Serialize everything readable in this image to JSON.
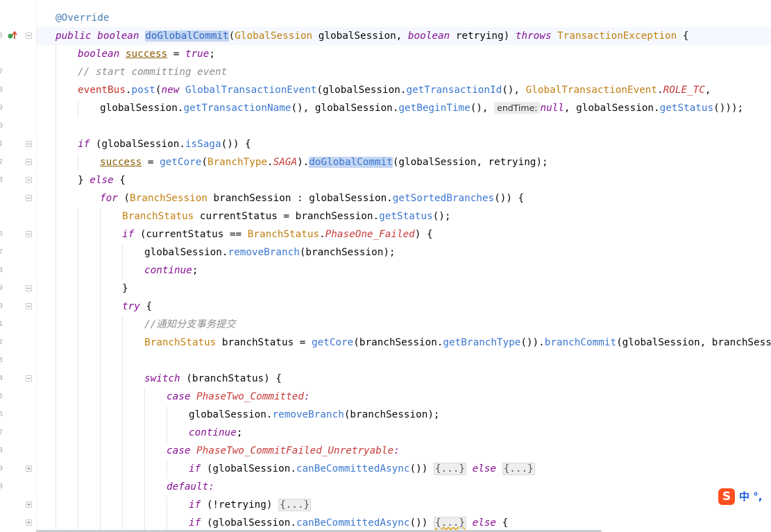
{
  "gutter": {
    "line_number_fragments": [
      "5",
      "7",
      "8",
      "9",
      "0",
      "1",
      "2",
      "3",
      "6",
      "7",
      "8",
      "9",
      "0",
      "1",
      "2",
      "3",
      "4",
      "5",
      "6",
      "7",
      "8",
      "9",
      "0"
    ]
  },
  "editor": {
    "annotation": "@Override",
    "sig_public": "public",
    "sig_boolean": "boolean",
    "sig_method": "doGlobalCommit",
    "sig_param_type": "GlobalSession",
    "sig_param_name": "globalSession,",
    "sig_boolean2": "boolean",
    "sig_retrying": "retrying)",
    "sig_throws": "throws",
    "sig_exception": "TransactionException",
    "sig_brace": "{",
    "l2_kw": "boolean",
    "l2_var": "success",
    "l2_eq": " = ",
    "l2_true": "true",
    "l2_end": ";",
    "l3_comment": "// start committing event",
    "l4_eventbus": "eventBus",
    "l4_dot": ".",
    "l4_post": "post",
    "l4_paren": "(",
    "l4_new": "new",
    "l4_gte": "GlobalTransactionEvent",
    "l4_gs": "(globalSession.",
    "l4_gettid": "getTransactionId",
    "l4_paren2": "(), ",
    "l4_gte2": "GlobalTransactionEvent",
    "l4_dot2": ".",
    "l4_role": "ROLE_TC",
    "l4_comma": ",",
    "l5_gs": "globalSession.",
    "l5_gtn": "getTransactionName",
    "l5_mid": "(), globalSession.",
    "l5_gbt": "getBeginTime",
    "l5_paren": "(), ",
    "l5_hint": "endTime:",
    "l5_null": "null",
    "l5_mid2": ", globalSession.",
    "l5_gst": "getStatus",
    "l5_end": "()));",
    "l7_if": "if",
    "l7_mid": " (globalSession.",
    "l7_issaga": "isSaga",
    "l7_end": "()) {",
    "l8_var": "success",
    "l8_eq": " = ",
    "l8_getcore": "getCore",
    "l8_paren": "(",
    "l8_bt": "BranchType",
    "l8_dot": ".",
    "l8_saga": "SAGA",
    "l8_close": ").",
    "l8_dgc": "doGlobalCommit",
    "l8_end": "(globalSession, retrying);",
    "l9_close": "} ",
    "l9_else": "else",
    "l9_brace": " {",
    "l10_for": "for",
    "l10_paren": " (",
    "l10_bs": "BranchSession",
    "l10_bsv": " branchSession : globalSession.",
    "l10_gsb": "getSortedBranches",
    "l10_end": "()) {",
    "l11_bst": "BranchStatus",
    "l11_mid": " currentStatus = branchSession.",
    "l11_gst": "getStatus",
    "l11_end": "();",
    "l12_if": "if",
    "l12_mid": " (currentStatus == ",
    "l12_bst": "BranchStatus",
    "l12_dot": ".",
    "l12_p1f": "PhaseOne_Failed",
    "l12_end": ") {",
    "l13_gs": "globalSession.",
    "l13_rb": "removeBranch",
    "l13_end": "(branchSession);",
    "l14_cont": "continue",
    "l14_end": ";",
    "l15_close": "}",
    "l16_try": "try",
    "l16_brace": " {",
    "l17_comment": "//通知分支事务提交",
    "l18_bst": "BranchStatus",
    "l18_mid": " branchStatus = ",
    "l18_getcore": "getCore",
    "l18_paren": "(branchSession.",
    "l18_gbt": "getBranchType",
    "l18_mid2": "()).",
    "l18_bc": "branchCommit",
    "l18_end": "(globalSession, branchSession);",
    "l20_switch": "switch",
    "l20_end": " (branchStatus) {",
    "l21_case": "case",
    "l21_const": "PhaseTwo_Committed",
    "l21_colon": ":",
    "l22_gs": "globalSession.",
    "l22_rb": "removeBranch",
    "l22_end": "(branchSession);",
    "l23_cont": "continue",
    "l23_end": ";",
    "l24_case": "case",
    "l24_const": "PhaseTwo_CommitFailed_Unretryable",
    "l24_colon": ":",
    "l25_if": "if",
    "l25_mid": " (globalSession.",
    "l25_cbca": "canBeCommittedAsync",
    "l25_paren": "()) ",
    "l25_fold1": "{...}",
    "l25_else": "else",
    "l25_fold2": "{...}",
    "l26_default": "default",
    "l26_colon": ":",
    "l27_if": "if",
    "l27_mid": " (!retrying) ",
    "l27_fold": "{...}",
    "l28_if": "if",
    "l28_mid": " (globalSession.",
    "l28_cbca": "canBeCommittedAsync",
    "l28_paren": "()) ",
    "l28_fold": "{...}",
    "l28_else": "else",
    "l28_brace": " {"
  },
  "ime": {
    "logo": "S",
    "text": "中 °,"
  },
  "colors": {
    "keyword": "#0033b3",
    "method": "#3067c8",
    "type": "#b07e00",
    "constant": "#c73a3a",
    "comment": "#8c8c8c",
    "selection": "#c4d6f2",
    "ime_logo": "#ff4f1f"
  }
}
